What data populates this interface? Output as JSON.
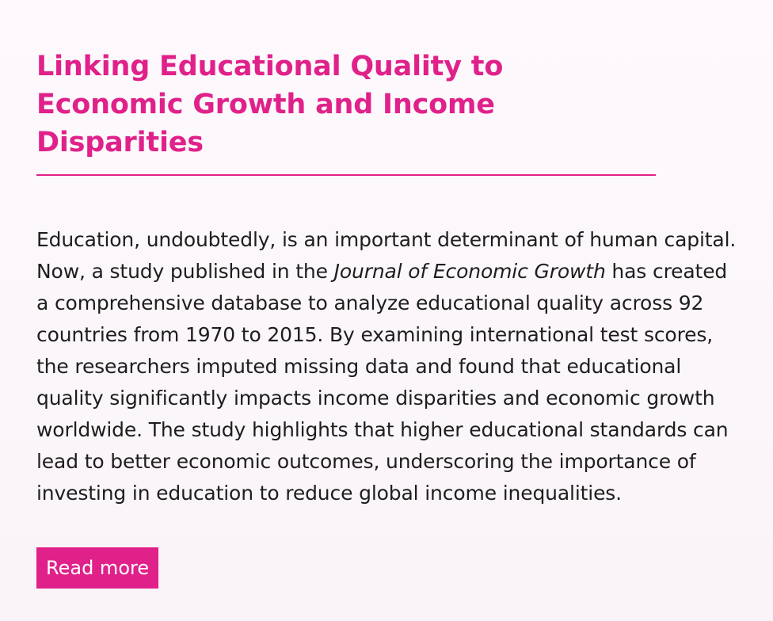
{
  "article": {
    "title": "Linking Educational Quality to Economic Growth and Income Disparities",
    "body_part1": "Education, undoubtedly, is an important determinant of human capital. Now, a study published in the ",
    "journal": "Journal of Economic Growth",
    "body_part2": " has created a comprehensive database to analyze educational quality across 92 countries from 1970 to 2015. By examining international test scores, the researchers imputed missing data and found that educational quality significantly impacts income disparities and economic growth worldwide. The study highlights that higher educational standards can lead to better economic outcomes, underscoring the importance of investing in education to reduce global income inequalities.",
    "read_more_label": "Read more"
  },
  "colors": {
    "accent": "#e0218a",
    "background": "#fbf7fa",
    "text": "#1e1e1e"
  }
}
